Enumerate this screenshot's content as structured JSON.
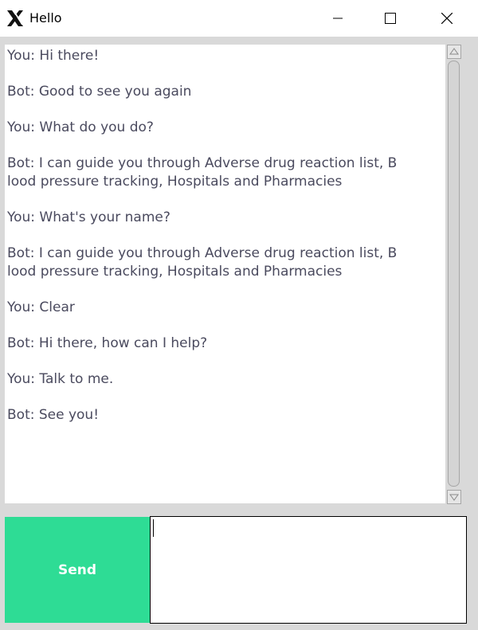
{
  "window": {
    "title": "Hello",
    "icons": {
      "app": "x-logo-icon",
      "minimize": "minimize-icon",
      "maximize": "maximize-icon",
      "close": "close-icon"
    }
  },
  "chat": {
    "messages": [
      "You: Hi there!",
      "Bot: Good to see you again",
      "You: What do you do?",
      "Bot: I can guide you through Adverse drug reaction list, B\nlood pressure tracking, Hospitals and Pharmacies",
      "You: What's your name?",
      "Bot: I can guide you through Adverse drug reaction list, B\nlood pressure tracking, Hospitals and Pharmacies",
      "You: Clear",
      "Bot: Hi there, how can I help?",
      "You: Talk to me.",
      "Bot: See you!"
    ]
  },
  "input": {
    "send_label": "Send",
    "value": ""
  },
  "colors": {
    "send_button": "#2edc95",
    "text": "#4a4a5e",
    "background": "#d9d9d9"
  }
}
